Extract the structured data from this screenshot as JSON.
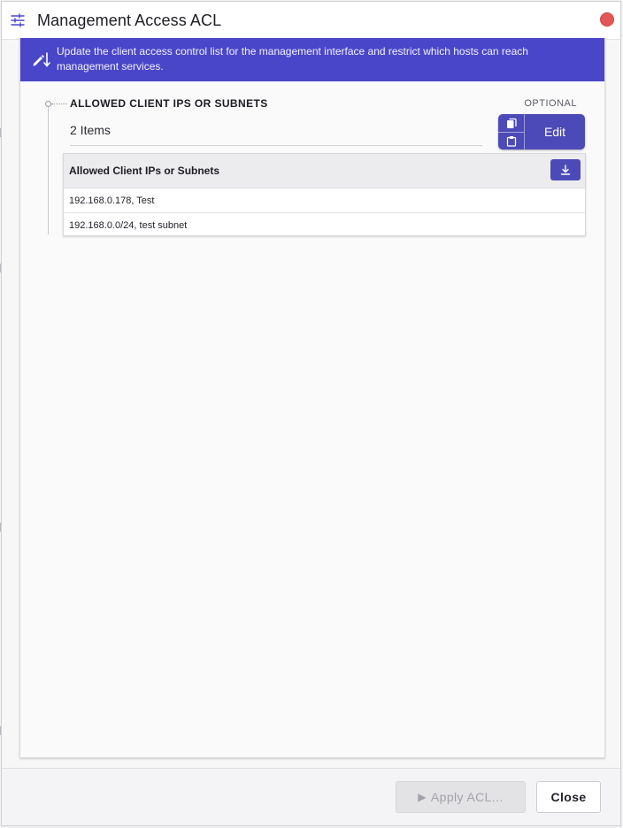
{
  "dialog": {
    "title": "Management Access ACL",
    "title_icon": "sliders-icon",
    "close_icon": "close-dot-icon"
  },
  "banner": {
    "icon": "pen-sort-icon",
    "text": "Update the client access control list for the management interface and restrict which hosts can reach management services.",
    "background": "#4a46c9"
  },
  "field": {
    "label": "ALLOWED CLIENT IPS OR SUBNETS",
    "optional": "OPTIONAL",
    "count": "2 Items",
    "copy_icon": "copy-icon",
    "paste_icon": "clipboard-icon",
    "edit_label": "Edit"
  },
  "table": {
    "header": "Allowed Client IPs or Subnets",
    "download_icon": "download-icon",
    "rows": [
      "192.168.0.178, Test",
      "192.168.0.0/24, test subnet"
    ]
  },
  "footer": {
    "apply_label": "Apply ACL...",
    "apply_icon": "play-icon",
    "close_label": "Close"
  },
  "colors": {
    "accent": "#4c4ab8",
    "close_dot": "#e35656"
  }
}
